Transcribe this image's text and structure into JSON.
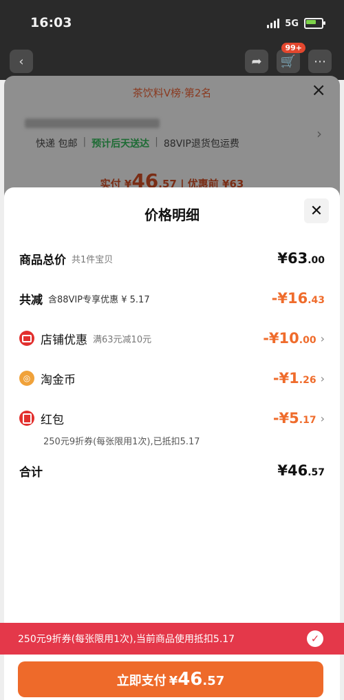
{
  "status": {
    "time": "16:03",
    "network": "5G"
  },
  "background": {
    "cart_badge": "99+",
    "rank": "茶饮料V榜·第2名",
    "shipping": [
      "快递 包邮",
      "预计后天送达",
      "88VIP退货包运费"
    ],
    "price_prefix": "实付 ¥",
    "price_int": "46",
    "price_dec": ".57",
    "price_before": "优惠前 ¥63"
  },
  "sheet": {
    "title": "价格明细",
    "rows": [
      {
        "label": "商品总价",
        "sub": "共1件宝贝",
        "int": "¥63",
        "dec": ".00"
      },
      {
        "label": "共减",
        "sub": "含88VIP专享优惠 ¥ 5.17",
        "int": "-¥16",
        "dec": ".43"
      },
      {
        "label": "店铺优惠",
        "sub": "满63元减10元",
        "int": "-¥10",
        "dec": ".00",
        "icon": "store-icon"
      },
      {
        "label": "淘金币",
        "int": "-¥1",
        "dec": ".26",
        "icon": "coin-icon"
      },
      {
        "label": "红包",
        "int": "-¥5",
        "dec": ".17",
        "icon": "red-packet-icon"
      },
      {
        "label": "合计",
        "int": "¥46",
        "dec": ".57"
      }
    ],
    "redpacket_note": "250元9折券(每张限用1次),已抵扣5.17"
  },
  "coupon": {
    "text": "250元9折券(每张限用1次),当前商品使用抵扣5.17"
  },
  "pay": {
    "label": "立即支付",
    "currency": "¥",
    "int": "46",
    "dec": ".57"
  }
}
